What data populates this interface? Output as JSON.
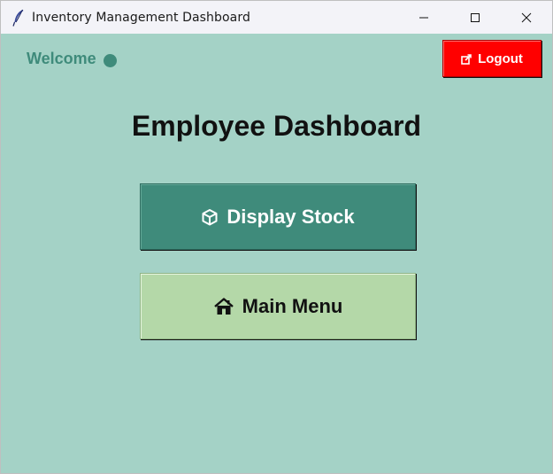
{
  "window": {
    "title": "Inventory Management Dashboard",
    "controls": [
      "minimize",
      "maximize",
      "close"
    ]
  },
  "header": {
    "welcome_label": "Welcome",
    "logout_label": "Logout",
    "logout_icon": "logout-icon"
  },
  "main": {
    "title": "Employee Dashboard",
    "buttons": [
      {
        "label": "Display Stock",
        "icon": "package-icon"
      },
      {
        "label": "Main Menu",
        "icon": "house-icon"
      }
    ]
  },
  "colors": {
    "background": "#a4d2c6",
    "primary_button": "#3f8b7b",
    "secondary_button": "#b4d8a8",
    "logout_button": "#ff0000",
    "welcome_text": "#3f8b7b",
    "titlebar": "#f3f3f8"
  }
}
